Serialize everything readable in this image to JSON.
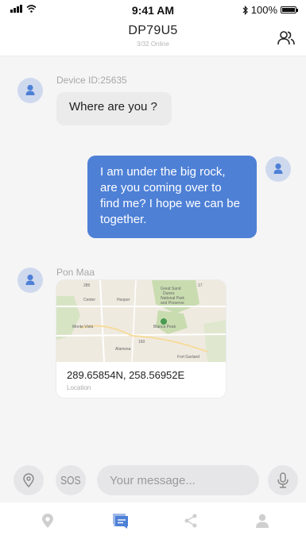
{
  "status_bar": {
    "time": "9:41 AM",
    "battery": "100%"
  },
  "header": {
    "title": "DP79U5",
    "subtitle": "3/32 Online"
  },
  "messages": [
    {
      "sender": "Device ID:25635",
      "text": "Where are you ?"
    },
    {
      "text_lines": [
        "I am under the big rock,",
        "are you coming over to",
        "find me? I hope we can be",
        "together."
      ]
    },
    {
      "sender": "Pon Maa",
      "coordinates": "289.65854N, 258.56952E",
      "location_label": "Location"
    }
  ],
  "map_labels": [
    "Center",
    "Hooper",
    "Great Sand",
    "Dunes",
    "National Park",
    "and Preserve",
    "Blanca Peak",
    "Monte Vista",
    "Alamosa",
    "Fort Garland",
    "285",
    "17",
    "160"
  ],
  "composer": {
    "sos_label": "SOS",
    "placeholder": "Your message..."
  },
  "colors": {
    "accent": "#4e80d6",
    "bubble_in": "#ebebeb",
    "avatar": "#cfd9ee",
    "chat_bg": "#f5f5f6"
  },
  "tabs": [
    {
      "icon": "location-pin-icon",
      "active": false
    },
    {
      "icon": "chat-icon",
      "active": true
    },
    {
      "icon": "share-icon",
      "active": false
    },
    {
      "icon": "user-icon",
      "active": false
    }
  ]
}
